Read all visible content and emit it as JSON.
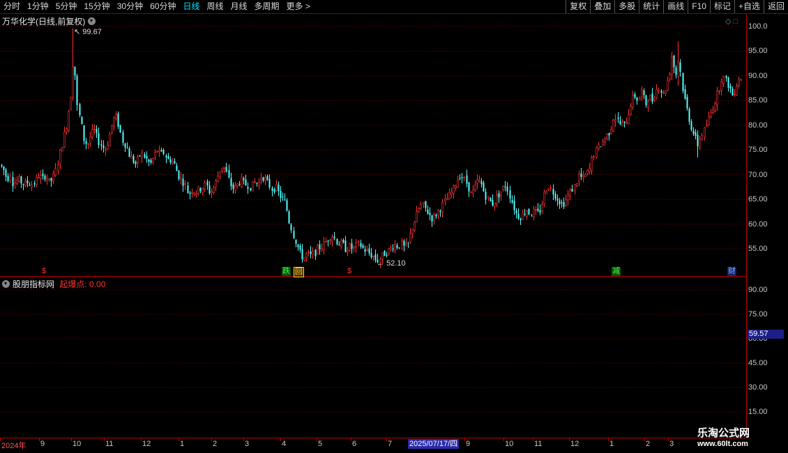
{
  "toolbar": {
    "periods": [
      "分时",
      "1分钟",
      "5分钟",
      "15分钟",
      "30分钟",
      "60分钟",
      "日线",
      "周线",
      "月线",
      "多周期",
      "更多 >"
    ],
    "active_period": "日线",
    "right_buttons": [
      "复权",
      "叠加",
      "多股",
      "统计",
      "画线",
      "F10",
      "标记",
      "+自选",
      "返回"
    ]
  },
  "main_chart": {
    "title": "万华化学(日线,前复权)",
    "high_label": "99.67",
    "low_label": "52.10",
    "y_ticks": [
      "100.0",
      "95.00",
      "90.00",
      "85.00",
      "80.00",
      "75.00",
      "70.00",
      "65.00",
      "60.00",
      "55.00"
    ],
    "signals": [
      {
        "text": "$",
        "style": "red"
      },
      {
        "text": "跌",
        "style": "green"
      },
      {
        "text": "回",
        "style": "orange"
      },
      {
        "text": "$",
        "style": "red"
      },
      {
        "text": "减",
        "style": "green"
      },
      {
        "text": "财",
        "style": "blue"
      }
    ]
  },
  "indicator_panel": {
    "name": "股朋指标网",
    "label": "起爆点: 0.00",
    "y_ticks": [
      "90.00",
      "75.00",
      "60.00",
      "45.00",
      "30.00",
      "15.00"
    ],
    "current_value": "59.57"
  },
  "x_axis": {
    "labels": [
      "2024年",
      "9",
      "10",
      "11",
      "12",
      "1",
      "2",
      "3",
      "4",
      "5",
      "6",
      "7",
      "9",
      "10",
      "11",
      "12",
      "1",
      "2",
      "3"
    ],
    "cursor_date": "2025/07/17/四"
  },
  "watermark": {
    "line1": "乐淘公式网",
    "line2": "www.60lt.com"
  },
  "colors": {
    "up": "#ff3232",
    "down": "#54ffff",
    "grid": "#8a0000",
    "frame": "#c00000",
    "active": "#00e5ff"
  },
  "chart_data": {
    "type": "candlestick",
    "title": "万华化学(日线,前复权)",
    "y_range": [
      50,
      100
    ],
    "price_path": [
      [
        0,
        72
      ],
      [
        5,
        71
      ],
      [
        10,
        69
      ],
      [
        15,
        70.5
      ],
      [
        18,
        68
      ],
      [
        25,
        69
      ],
      [
        30,
        68.5
      ],
      [
        35,
        68
      ],
      [
        40,
        68.5
      ],
      [
        45,
        68
      ],
      [
        50,
        68.5
      ],
      [
        55,
        70
      ],
      [
        60,
        69
      ],
      [
        65,
        70
      ],
      [
        70,
        68.5
      ],
      [
        75,
        69
      ],
      [
        80,
        71
      ],
      [
        85,
        74
      ],
      [
        90,
        77
      ],
      [
        95,
        80
      ],
      [
        100,
        85
      ],
      [
        103,
        88
      ],
      [
        105,
        95
      ],
      [
        108,
        89
      ],
      [
        110,
        84
      ],
      [
        115,
        81
      ],
      [
        120,
        77
      ],
      [
        125,
        76
      ],
      [
        130,
        78
      ],
      [
        135,
        79
      ],
      [
        140,
        77
      ],
      [
        145,
        76
      ],
      [
        150,
        75
      ],
      [
        155,
        77
      ],
      [
        160,
        80
      ],
      [
        165,
        82
      ],
      [
        170,
        80
      ],
      [
        175,
        77
      ],
      [
        180,
        76
      ],
      [
        185,
        74
      ],
      [
        190,
        73
      ],
      [
        195,
        72
      ],
      [
        200,
        74
      ],
      [
        205,
        74
      ],
      [
        210,
        73
      ],
      [
        215,
        72
      ],
      [
        220,
        73.5
      ],
      [
        225,
        75
      ],
      [
        230,
        74
      ],
      [
        235,
        74.5
      ],
      [
        240,
        73
      ],
      [
        245,
        73
      ],
      [
        250,
        72
      ],
      [
        255,
        70
      ],
      [
        260,
        69
      ],
      [
        265,
        68
      ],
      [
        270,
        66
      ],
      [
        275,
        67
      ],
      [
        280,
        66.5
      ],
      [
        285,
        67
      ],
      [
        290,
        67.5
      ],
      [
        295,
        68
      ],
      [
        300,
        66.5
      ],
      [
        305,
        67
      ],
      [
        310,
        69
      ],
      [
        315,
        71
      ],
      [
        320,
        72
      ],
      [
        325,
        70
      ],
      [
        330,
        68
      ],
      [
        335,
        67
      ],
      [
        340,
        68
      ],
      [
        345,
        69
      ],
      [
        350,
        68
      ],
      [
        355,
        68
      ],
      [
        360,
        67.5
      ],
      [
        365,
        68.5
      ],
      [
        370,
        68
      ],
      [
        375,
        70
      ],
      [
        380,
        69
      ],
      [
        385,
        68
      ],
      [
        390,
        67
      ],
      [
        395,
        67.5
      ],
      [
        400,
        66
      ],
      [
        405,
        65
      ],
      [
        410,
        64
      ],
      [
        413,
        61
      ],
      [
        416,
        60
      ],
      [
        420,
        58
      ],
      [
        425,
        56
      ],
      [
        430,
        54
      ],
      [
        435,
        53
      ],
      [
        440,
        54
      ],
      [
        445,
        53.5
      ],
      [
        450,
        54
      ],
      [
        455,
        55
      ],
      [
        460,
        55.5
      ],
      [
        465,
        56
      ],
      [
        470,
        57
      ],
      [
        475,
        58
      ],
      [
        480,
        57
      ],
      [
        485,
        56
      ],
      [
        490,
        56
      ],
      [
        495,
        55
      ],
      [
        500,
        55.5
      ],
      [
        505,
        55
      ],
      [
        510,
        55.5
      ],
      [
        515,
        56
      ],
      [
        520,
        55
      ],
      [
        525,
        54.5
      ],
      [
        530,
        54
      ],
      [
        535,
        53.5
      ],
      [
        540,
        52.5
      ],
      [
        545,
        53
      ],
      [
        550,
        54
      ],
      [
        555,
        54.5
      ],
      [
        560,
        55
      ],
      [
        565,
        56
      ],
      [
        570,
        55.5
      ],
      [
        575,
        56
      ],
      [
        580,
        55
      ],
      [
        585,
        56
      ],
      [
        590,
        59
      ],
      [
        595,
        61
      ],
      [
        600,
        63
      ],
      [
        605,
        64
      ],
      [
        610,
        63
      ],
      [
        615,
        62
      ],
      [
        620,
        61
      ],
      [
        625,
        62
      ],
      [
        630,
        63
      ],
      [
        635,
        64
      ],
      [
        640,
        65
      ],
      [
        645,
        66
      ],
      [
        650,
        67
      ],
      [
        655,
        69
      ],
      [
        660,
        70
      ],
      [
        665,
        69
      ],
      [
        670,
        68
      ],
      [
        675,
        66
      ],
      [
        680,
        67
      ],
      [
        685,
        69
      ],
      [
        690,
        68
      ],
      [
        695,
        66
      ],
      [
        700,
        65
      ],
      [
        705,
        64
      ],
      [
        710,
        65
      ],
      [
        715,
        66
      ],
      [
        720,
        67
      ],
      [
        725,
        68
      ],
      [
        730,
        66
      ],
      [
        735,
        64
      ],
      [
        740,
        62
      ],
      [
        745,
        61.5
      ],
      [
        750,
        62
      ],
      [
        755,
        63
      ],
      [
        760,
        62
      ],
      [
        765,
        62.5
      ],
      [
        770,
        62
      ],
      [
        775,
        63
      ],
      [
        780,
        66
      ],
      [
        785,
        68
      ],
      [
        790,
        67
      ],
      [
        795,
        66
      ],
      [
        800,
        65
      ],
      [
        805,
        64
      ],
      [
        810,
        64.5
      ],
      [
        815,
        66
      ],
      [
        820,
        67
      ],
      [
        825,
        68
      ],
      [
        830,
        70
      ],
      [
        835,
        69
      ],
      [
        840,
        70
      ],
      [
        845,
        71
      ],
      [
        850,
        74
      ],
      [
        855,
        75
      ],
      [
        860,
        76
      ],
      [
        865,
        77
      ],
      [
        870,
        78
      ],
      [
        875,
        79
      ],
      [
        880,
        82
      ],
      [
        885,
        81
      ],
      [
        890,
        80
      ],
      [
        895,
        80
      ],
      [
        900,
        82
      ],
      [
        905,
        85
      ],
      [
        910,
        86
      ],
      [
        915,
        85
      ],
      [
        920,
        87
      ],
      [
        925,
        84
      ],
      [
        930,
        86
      ],
      [
        935,
        85
      ],
      [
        940,
        87
      ],
      [
        945,
        88
      ],
      [
        950,
        86
      ],
      [
        955,
        88
      ],
      [
        960,
        91
      ],
      [
        963,
        94
      ],
      [
        966,
        92
      ],
      [
        970,
        90
      ],
      [
        973,
        94
      ],
      [
        976,
        90
      ],
      [
        980,
        86
      ],
      [
        985,
        83
      ],
      [
        990,
        80
      ],
      [
        995,
        78
      ],
      [
        1000,
        76
      ],
      [
        1005,
        78
      ],
      [
        1010,
        79
      ],
      [
        1015,
        81
      ],
      [
        1020,
        83
      ],
      [
        1025,
        85
      ],
      [
        1030,
        87
      ],
      [
        1035,
        90
      ],
      [
        1040,
        89
      ],
      [
        1045,
        88
      ],
      [
        1050,
        86
      ],
      [
        1055,
        88
      ],
      [
        1060,
        90
      ],
      [
        1063,
        89
      ]
    ]
  }
}
